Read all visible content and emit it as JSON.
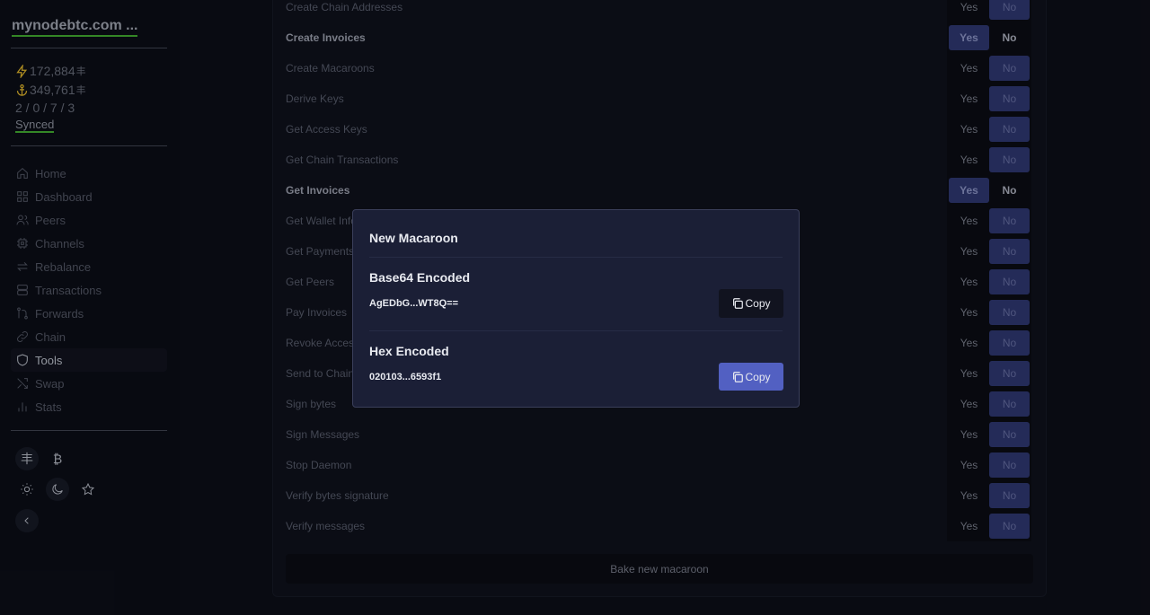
{
  "sidebar": {
    "host": "mynodebtc.com ...",
    "lightning_balance": "172,884",
    "onchain_balance": "349,761",
    "channel_counts": "2 / 0 / 7 / 3",
    "sync_status": "Synced",
    "items": [
      {
        "label": "Home",
        "icon": "home-icon"
      },
      {
        "label": "Dashboard",
        "icon": "grid-icon"
      },
      {
        "label": "Peers",
        "icon": "users-icon"
      },
      {
        "label": "Channels",
        "icon": "chip-icon"
      },
      {
        "label": "Rebalance",
        "icon": "arrows-icon"
      },
      {
        "label": "Transactions",
        "icon": "server-icon"
      },
      {
        "label": "Forwards",
        "icon": "git-icon"
      },
      {
        "label": "Chain",
        "icon": "link-icon"
      },
      {
        "label": "Tools",
        "icon": "shield-icon",
        "active": true
      },
      {
        "label": "Swap",
        "icon": "shuffle-icon"
      },
      {
        "label": "Stats",
        "icon": "bar-chart-icon"
      }
    ],
    "sats_symbol": "丰",
    "btc_symbol": "₿"
  },
  "permissions": [
    {
      "label": "Create Chain Addresses",
      "value": "No"
    },
    {
      "label": "Create Invoices",
      "value": "Yes"
    },
    {
      "label": "Create Macaroons",
      "value": "No"
    },
    {
      "label": "Derive Keys",
      "value": "No"
    },
    {
      "label": "Get Access Keys",
      "value": "No"
    },
    {
      "label": "Get Chain Transactions",
      "value": "No"
    },
    {
      "label": "Get Invoices",
      "value": "Yes"
    },
    {
      "label": "Get Wallet Info",
      "value": "No"
    },
    {
      "label": "Get Payments",
      "value": "No"
    },
    {
      "label": "Get Peers",
      "value": "No"
    },
    {
      "label": "Pay Invoices",
      "value": "No"
    },
    {
      "label": "Revoke Access",
      "value": "No"
    },
    {
      "label": "Send to Chain",
      "value": "No"
    },
    {
      "label": "Sign bytes",
      "value": "No"
    },
    {
      "label": "Sign Messages",
      "value": "No"
    },
    {
      "label": "Stop Daemon",
      "value": "No"
    },
    {
      "label": "Verify bytes signature",
      "value": "No"
    },
    {
      "label": "Verify messages",
      "value": "No"
    }
  ],
  "toggle": {
    "yes": "Yes",
    "no": "No"
  },
  "bake_label": "Bake new macaroon",
  "modal": {
    "title": "New Macaroon",
    "base64_heading": "Base64 Encoded",
    "base64_value": "AgEDbG...WT8Q==",
    "hex_heading": "Hex Encoded",
    "hex_value": "020103...6593f1",
    "copy_label": "Copy"
  },
  "colors": {
    "accent": "#5260c2",
    "selected": "#293165",
    "synced": "#3c9a2c",
    "icon_gold": "#c9a227"
  }
}
